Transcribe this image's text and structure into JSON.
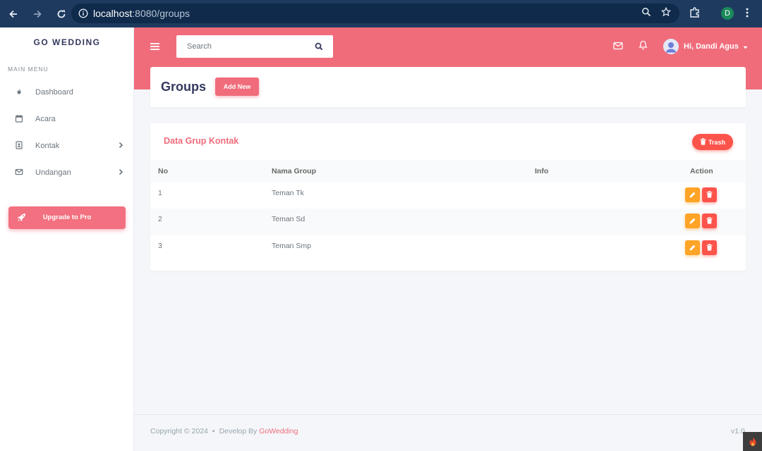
{
  "browser": {
    "url_host": "localhost",
    "url_path": ":8080/groups",
    "profile_initial": "D"
  },
  "sidebar": {
    "brand": "GO WEDDING",
    "menu_header": "MAIN MENU",
    "items": [
      {
        "label": "Dashboard",
        "icon": "fire-icon",
        "has_submenu": false
      },
      {
        "label": "Acara",
        "icon": "calendar-icon",
        "has_submenu": false
      },
      {
        "label": "Kontak",
        "icon": "contact-book-icon",
        "has_submenu": true
      },
      {
        "label": "Undangan",
        "icon": "envelope-icon",
        "has_submenu": true
      }
    ],
    "upgrade_label": "Upgrade to Pro"
  },
  "topbar": {
    "search_placeholder": "Search",
    "user_greeting": "Hi, Dandi Agus"
  },
  "page": {
    "title": "Groups",
    "add_new_label": "Add New"
  },
  "card": {
    "title": "Data Grup Kontak",
    "trash_label": "Trash",
    "columns": [
      "No",
      "Nama Group",
      "Info",
      "Action"
    ],
    "rows": [
      {
        "no": "1",
        "nama_group": "Teman Tk",
        "info": ""
      },
      {
        "no": "2",
        "nama_group": "Teman Sd",
        "info": ""
      },
      {
        "no": "3",
        "nama_group": "Teman Smp",
        "info": ""
      }
    ]
  },
  "footer": {
    "copyright": "Copyright © 2024",
    "separator": "•",
    "develop_by": "Develop By",
    "developer": "GoWedding",
    "version": "v1.0"
  },
  "colors": {
    "primary": "#f06c7b",
    "warning": "#ffa426",
    "danger": "#fc544b",
    "sidebar_bg": "#ffffff",
    "page_bg": "#f4f6f9"
  }
}
